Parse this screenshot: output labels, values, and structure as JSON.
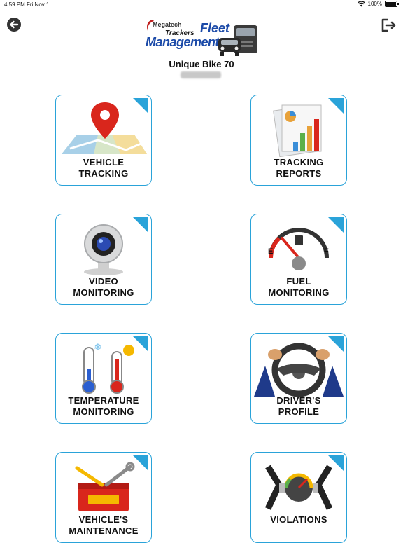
{
  "status_bar": {
    "time": "4:59 PM",
    "date": "Fri Nov 1",
    "battery": "100%",
    "battery_level": 1.0
  },
  "logo": {
    "line1": "Megatech",
    "line2": "Trackers",
    "line3": "Fleet",
    "line4": "Management"
  },
  "vehicle": {
    "name": "Unique Bike 70"
  },
  "tiles": [
    {
      "line1": "VEHICLE",
      "line2": "TRACKING",
      "icon": "map-pin-icon"
    },
    {
      "line1": "TRACKING",
      "line2": "REPORTS",
      "icon": "report-chart-icon"
    },
    {
      "line1": "VIDEO",
      "line2": "MONITORING",
      "icon": "webcam-icon"
    },
    {
      "line1": "FUEL",
      "line2": "MONITORING",
      "icon": "fuel-gauge-icon"
    },
    {
      "line1": "TEMPERATURE",
      "line2": "MONITORING",
      "icon": "thermometer-icon"
    },
    {
      "line1": "DRIVER'S",
      "line2": "PROFILE",
      "icon": "steering-wheel-icon"
    },
    {
      "line1": "VEHICLE'S",
      "line2": "MAINTENANCE",
      "icon": "toolbox-icon"
    },
    {
      "line1": "",
      "line2": "VIOLATIONS",
      "icon": "seatbelt-icon"
    }
  ],
  "colors": {
    "accent": "#2aa3d9",
    "brand": "#1b4aa8"
  }
}
